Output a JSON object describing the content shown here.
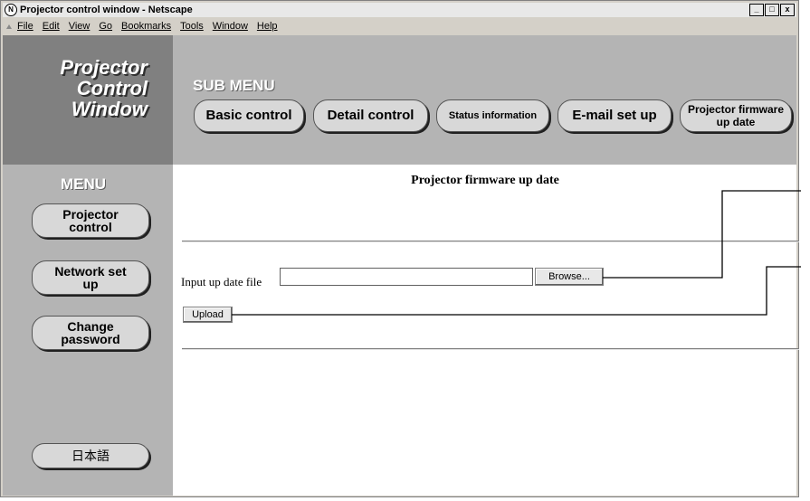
{
  "window": {
    "title": "Projector control window - Netscape",
    "icon": "netscape-icon",
    "controls": [
      "_",
      "□",
      "x"
    ]
  },
  "menubar": [
    "File",
    "Edit",
    "View",
    "Go",
    "Bookmarks",
    "Tools",
    "Window",
    "Help"
  ],
  "logo": {
    "text": "Projector\nControl\nWindow"
  },
  "submenu": {
    "title": "SUB MENU",
    "buttons": [
      "Basic control",
      "Detail control",
      "Status information",
      "E-mail set up",
      "Projector firmware up date"
    ]
  },
  "menu": {
    "title": "MENU",
    "buttons": [
      "Projector control",
      "Network set up",
      "Change password",
      "日本語"
    ]
  },
  "main": {
    "heading": "Projector firmware up date",
    "file_label": "Input up date file",
    "file_value": "",
    "browse_label": "Browse...",
    "upload_label": "Upload"
  },
  "colors": {
    "logo_bg": "#808080",
    "panel_bg": "#b4b4b4",
    "pill_bg": "#d8d8d8"
  }
}
